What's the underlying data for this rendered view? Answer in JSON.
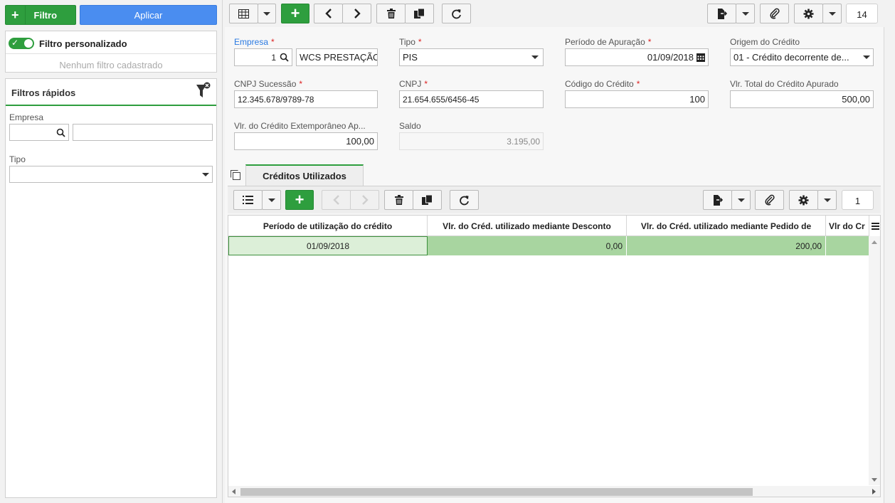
{
  "sidebar": {
    "filter_button": "Filtro",
    "apply_button": "Aplicar",
    "custom_filter_label": "Filtro personalizado",
    "no_filter_text": "Nenhum filtro cadastrado",
    "quick_filters_title": "Filtros rápidos",
    "empresa_label": "Empresa",
    "tipo_label": "Tipo"
  },
  "toolbar": {
    "record_count": "14"
  },
  "form": {
    "empresa": {
      "label": "Empresa",
      "code": "1",
      "name": "WCS PRESTAÇÃO"
    },
    "tipo": {
      "label": "Tipo",
      "value": "PIS"
    },
    "periodo": {
      "label": "Período de Apuração",
      "value": "01/09/2018"
    },
    "origem": {
      "label": "Origem do Crédito",
      "value": "01 - Crédito decorrente de..."
    },
    "cnpj_sucessao": {
      "label": "CNPJ Sucessão",
      "value": "12.345.678/9789-78"
    },
    "cnpj": {
      "label": "CNPJ",
      "value": "21.654.655/6456-45"
    },
    "codigo_credito": {
      "label": "Código do Crédito",
      "value": "100"
    },
    "vlr_total": {
      "label": "Vlr. Total do Crédito Apurado",
      "value": "500,00"
    },
    "vlr_extemporaneo": {
      "label": "Vlr. do Crédito Extemporâneo Ap...",
      "value": "100,00"
    },
    "saldo": {
      "label": "Saldo",
      "value": "3.195,00"
    }
  },
  "tab": {
    "label": "Créditos Utilizados"
  },
  "grid": {
    "record_count": "1",
    "columns": [
      "Período de utilização do crédito",
      "Vlr. do Créd. utilizado mediante Desconto",
      "Vlr. do Créd. utilizado mediante Pedido de",
      "Vlr do Cr"
    ],
    "rows": [
      [
        "01/09/2018",
        "0,00",
        "200,00",
        ""
      ]
    ]
  },
  "colors": {
    "green": "#2e9e3e",
    "blue": "#4a8df0",
    "row_selected": "#a8d5a0",
    "row_first_cell": "#dcefd8"
  }
}
